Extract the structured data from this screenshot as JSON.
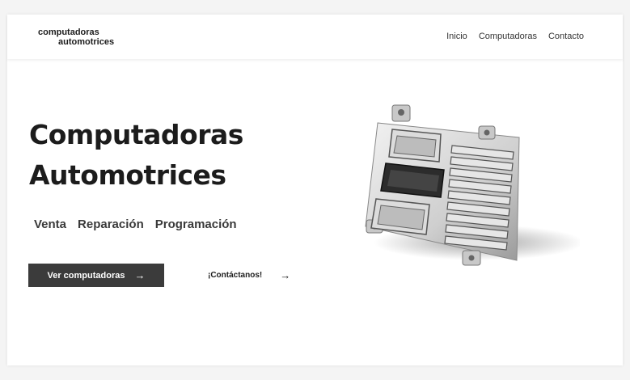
{
  "header": {
    "logo_line1": "computadoras",
    "logo_line2": "automotrices",
    "nav": [
      "Inicio",
      "Computadoras",
      "Contacto"
    ]
  },
  "hero": {
    "title_line1": "Computadoras",
    "title_line2": "Automotrices",
    "services": [
      "Venta",
      "Reparación",
      "Programación"
    ],
    "primary_button": "Ver computadoras",
    "secondary_button": "¡Contáctanos!",
    "arrow": "→"
  },
  "colors": {
    "text": "#1c1c1c",
    "button_bg": "#3b3b3b",
    "page_bg": "#ffffff"
  },
  "icons": {
    "button_arrow": "arrow-right-icon",
    "product_image": "ecu-image"
  }
}
